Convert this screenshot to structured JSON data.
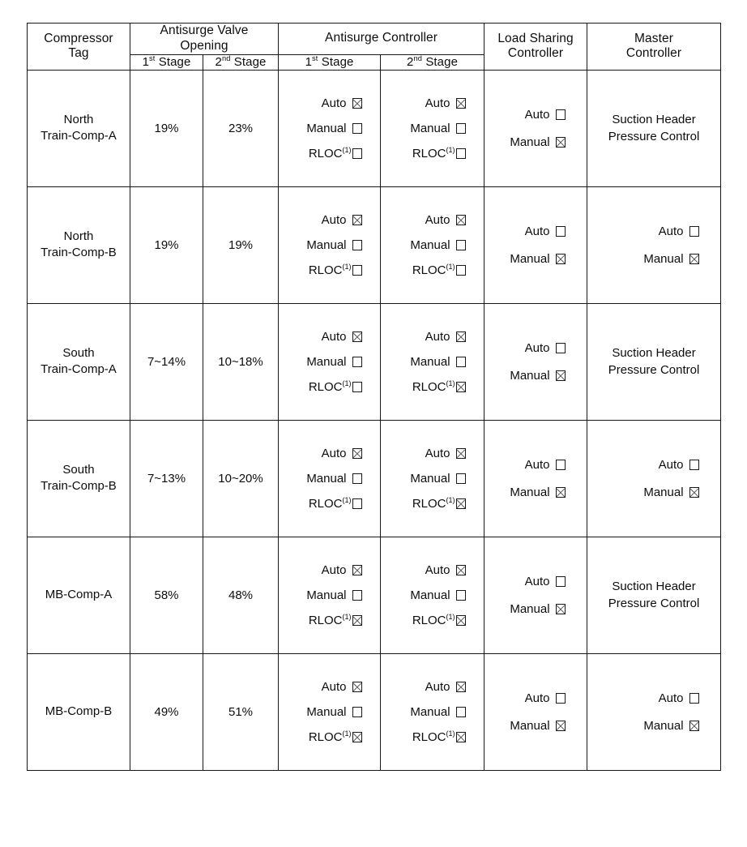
{
  "table": {
    "headers": {
      "compressor_tag": "Compressor Tag",
      "compressor_tag_line1": "Compressor",
      "compressor_tag_line2": "Tag",
      "antisurge_valve_opening": "Antisurge Valve Opening",
      "antisurge_valve_line1": "Antisurge Valve",
      "antisurge_valve_line2": "Opening",
      "antisurge_controller": "Antisurge Controller",
      "load_sharing_controller_line1": "Load Sharing",
      "load_sharing_controller_line2": "Controller",
      "master_controller_line1": "Master",
      "master_controller_line2": "Controller",
      "stage1": "1st Stage",
      "stage1_num": "1",
      "stage1_sup": "st",
      "stage1_word": "Stage",
      "stage2": "2nd Stage",
      "stage2_num": "2",
      "stage2_sup": "nd",
      "stage2_word": "Stage"
    },
    "option_labels": {
      "auto": "Auto",
      "manual": "Manual",
      "rloc": "RLOC",
      "rloc_footnote": "(1)"
    },
    "rows": [
      {
        "tag_line1": "North",
        "tag_line2": "Train-Comp-A",
        "valve_stage1": "19%",
        "valve_stage2": "23%",
        "asc_stage1": {
          "auto": true,
          "manual": false,
          "rloc": false
        },
        "asc_stage2": {
          "auto": true,
          "manual": false,
          "rloc": false
        },
        "load_sharing": {
          "auto": false,
          "manual": true
        },
        "master_mode": "text",
        "master_text_line1": "Suction Header",
        "master_text_line2": "Pressure Control",
        "master_checks": {
          "auto": false,
          "manual": false
        }
      },
      {
        "tag_line1": "North",
        "tag_line2": "Train-Comp-B",
        "valve_stage1": "19%",
        "valve_stage2": "19%",
        "asc_stage1": {
          "auto": true,
          "manual": false,
          "rloc": false
        },
        "asc_stage2": {
          "auto": true,
          "manual": false,
          "rloc": false
        },
        "load_sharing": {
          "auto": false,
          "manual": true
        },
        "master_mode": "checks",
        "master_text_line1": "",
        "master_text_line2": "",
        "master_checks": {
          "auto": false,
          "manual": true
        }
      },
      {
        "tag_line1": "South",
        "tag_line2": "Train-Comp-A",
        "valve_stage1": "7~14%",
        "valve_stage2": "10~18%",
        "asc_stage1": {
          "auto": true,
          "manual": false,
          "rloc": false
        },
        "asc_stage2": {
          "auto": true,
          "manual": false,
          "rloc": true
        },
        "load_sharing": {
          "auto": false,
          "manual": true
        },
        "master_mode": "text",
        "master_text_line1": "Suction Header",
        "master_text_line2": "Pressure Control",
        "master_checks": {
          "auto": false,
          "manual": false
        }
      },
      {
        "tag_line1": "South",
        "tag_line2": "Train-Comp-B",
        "valve_stage1": "7~13%",
        "valve_stage2": "10~20%",
        "asc_stage1": {
          "auto": true,
          "manual": false,
          "rloc": false
        },
        "asc_stage2": {
          "auto": true,
          "manual": false,
          "rloc": true
        },
        "load_sharing": {
          "auto": false,
          "manual": true
        },
        "master_mode": "checks",
        "master_text_line1": "",
        "master_text_line2": "",
        "master_checks": {
          "auto": false,
          "manual": true
        }
      },
      {
        "tag_line1": "MB-Comp-A",
        "tag_line2": "",
        "valve_stage1": "58%",
        "valve_stage2": "48%",
        "asc_stage1": {
          "auto": true,
          "manual": false,
          "rloc": true
        },
        "asc_stage2": {
          "auto": true,
          "manual": false,
          "rloc": true
        },
        "load_sharing": {
          "auto": false,
          "manual": true
        },
        "master_mode": "text",
        "master_text_line1": "Suction Header",
        "master_text_line2": "Pressure Control",
        "master_checks": {
          "auto": false,
          "manual": false
        }
      },
      {
        "tag_line1": "MB-Comp-B",
        "tag_line2": "",
        "valve_stage1": "49%",
        "valve_stage2": "51%",
        "asc_stage1": {
          "auto": true,
          "manual": false,
          "rloc": true
        },
        "asc_stage2": {
          "auto": true,
          "manual": false,
          "rloc": true
        },
        "load_sharing": {
          "auto": false,
          "manual": true
        },
        "master_mode": "checks",
        "master_text_line1": "",
        "master_text_line2": "",
        "master_checks": {
          "auto": false,
          "manual": true
        }
      }
    ]
  },
  "colors": {
    "border": "#181818",
    "text": "#0d0d0d",
    "check_mark": "#555555",
    "background": "#ffffff"
  }
}
